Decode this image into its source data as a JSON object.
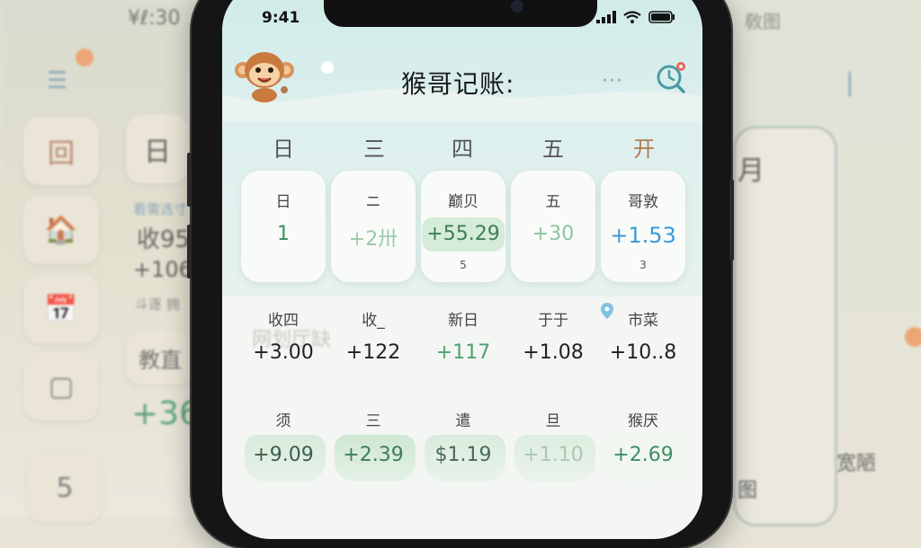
{
  "background": {
    "left": {
      "time": "¥ℓ:30",
      "tiles": [
        "回",
        "🏠",
        "📅",
        "▢"
      ],
      "day_tile": "日",
      "caption": "看需选寸",
      "amount1": "收95",
      "amount2": "+106",
      "caption2": "斗逐 拥",
      "label": "教直",
      "amount3": "+36",
      "glyph": "5"
    },
    "right": {
      "status": "敎图",
      "month": "月",
      "text1": "宽陋",
      "text2": "图"
    },
    "overlay_text": "网划厅缺"
  },
  "status_bar": {
    "time": "9:41"
  },
  "header": {
    "title": "猴哥记账:",
    "more": "···"
  },
  "weekdays": [
    "日",
    "三",
    "四",
    "五",
    "开"
  ],
  "row1": [
    {
      "label": "日",
      "value": "1",
      "sub": ""
    },
    {
      "label": "ニ",
      "value": "+2卅",
      "sub": ""
    },
    {
      "label": "巅贝",
      "value": "+55.29",
      "sub": "5"
    },
    {
      "label": "五",
      "value": "+30",
      "sub": ""
    },
    {
      "label": "哥敦",
      "value": "+1.53",
      "sub": "3"
    }
  ],
  "row2": [
    {
      "label": "收四",
      "value": "+3.00"
    },
    {
      "label": "收_",
      "value": "+122"
    },
    {
      "label": "新日",
      "value": "+117"
    },
    {
      "label": "于于",
      "value": "+1.08"
    },
    {
      "label": "市菜",
      "value": "+10..8"
    }
  ],
  "row3": [
    {
      "label": "须",
      "value": "+9.09"
    },
    {
      "label": "三",
      "value": "+2.39"
    },
    {
      "label": "遣",
      "value": "$1.19"
    },
    {
      "label": "旦",
      "value": "+1.10"
    },
    {
      "label": "猴厌",
      "value": "+2.69"
    }
  ],
  "colors": {
    "green": "#3f8f61",
    "blue": "#3a9bd8",
    "accent": "#b07a4f"
  }
}
